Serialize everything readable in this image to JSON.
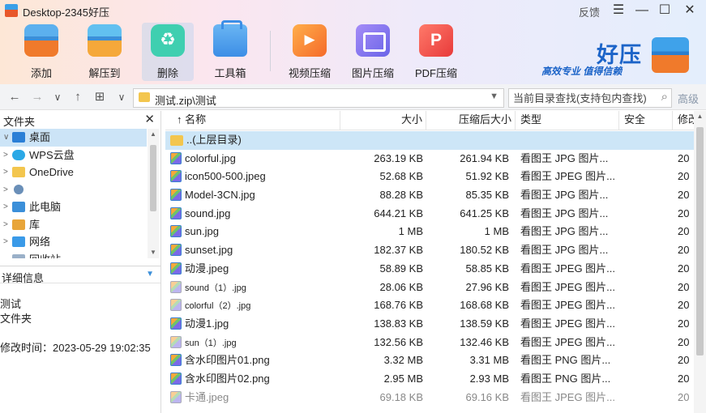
{
  "window": {
    "title": "Desktop-2345好压",
    "feedback_label": "反馈",
    "controls": {
      "menu": "☰",
      "minimize": "—",
      "maximize": "☐",
      "close": "✕"
    }
  },
  "toolbar": {
    "buttons": [
      {
        "label": "添加",
        "icon": "add-archive-icon"
      },
      {
        "label": "解压到",
        "icon": "extract-icon"
      },
      {
        "label": "删除",
        "icon": "recycle-icon"
      },
      {
        "label": "工具箱",
        "icon": "toolbox-icon"
      },
      {
        "label": "视频压缩",
        "icon": "video-compress-icon"
      },
      {
        "label": "图片压缩",
        "icon": "image-compress-icon"
      },
      {
        "label": "PDF压缩",
        "icon": "pdf-compress-icon"
      }
    ],
    "active": "删除"
  },
  "brand": {
    "name": "好压",
    "slogan": "高效专业 值得信赖"
  },
  "nav": {
    "back": "←",
    "forward": "→",
    "history": "∨",
    "up": "↑",
    "view": "⊞",
    "view_dropdown": "∨",
    "address": "测试.zip\\测试",
    "search_placeholder": "当前目录查找(支持包内查找)",
    "advanced_label": "高级"
  },
  "folder_panel": {
    "title": "文件夹",
    "items": [
      {
        "label": "桌面",
        "icon": "desktop-icon",
        "selected": true,
        "chevron": "∨"
      },
      {
        "label": "WPS云盘",
        "icon": "cloud-icon",
        "selected": false,
        "chevron": ">"
      },
      {
        "label": "OneDrive",
        "icon": "folder-icon",
        "selected": false,
        "chevron": ">"
      },
      {
        "label": "",
        "icon": "user-icon",
        "selected": false,
        "chevron": ">"
      },
      {
        "label": "此电脑",
        "icon": "computer-icon",
        "selected": false,
        "chevron": ">"
      },
      {
        "label": "库",
        "icon": "library-icon",
        "selected": false,
        "chevron": ">"
      },
      {
        "label": "网络",
        "icon": "network-icon",
        "selected": false,
        "chevron": ">"
      },
      {
        "label": "回收站",
        "icon": "recycle-bin-icon",
        "selected": false,
        "chevron": ""
      }
    ]
  },
  "details": {
    "title": "详细信息",
    "name": "测试",
    "type": "文件夹",
    "modified": "修改时间：2023-05-29 19:02:35"
  },
  "file_list": {
    "columns": [
      "名称",
      "大小",
      "压缩后大小",
      "类型",
      "安全",
      "修改"
    ],
    "sort_indicator": "↑",
    "rows": [
      {
        "name": "..(上层目录)",
        "size": "",
        "packed": "",
        "type": "",
        "mod": "",
        "kind": "dir",
        "style": "sel"
      },
      {
        "name": "colorful.jpg",
        "size": "263.19 KB",
        "packed": "261.94 KB",
        "type": "看图王 JPG 图片...",
        "mod": "20",
        "kind": "img",
        "style": ""
      },
      {
        "name": "icon500-500.jpeg",
        "size": "52.68 KB",
        "packed": "51.92 KB",
        "type": "看图王 JPEG 图片...",
        "mod": "20",
        "kind": "img",
        "style": ""
      },
      {
        "name": "Model-3CN.jpg",
        "size": "88.28 KB",
        "packed": "85.35 KB",
        "type": "看图王 JPG 图片...",
        "mod": "20",
        "kind": "img",
        "style": ""
      },
      {
        "name": "sound.jpg",
        "size": "644.21 KB",
        "packed": "641.25 KB",
        "type": "看图王 JPG 图片...",
        "mod": "20",
        "kind": "img",
        "style": ""
      },
      {
        "name": "sun.jpg",
        "size": "1 MB",
        "packed": "1 MB",
        "type": "看图王 JPG 图片...",
        "mod": "20",
        "kind": "img",
        "style": ""
      },
      {
        "name": "sunset.jpg",
        "size": "182.37 KB",
        "packed": "180.52 KB",
        "type": "看图王 JPG 图片...",
        "mod": "20",
        "kind": "img",
        "style": ""
      },
      {
        "name": "动漫.jpeg",
        "size": "58.89 KB",
        "packed": "58.85 KB",
        "type": "看图王 JPEG 图片...",
        "mod": "20",
        "kind": "img",
        "style": ""
      },
      {
        "name": "sound（1）.jpg",
        "size": "28.06 KB",
        "packed": "27.96 KB",
        "type": "看图王 JPEG 图片...",
        "mod": "20",
        "kind": "img",
        "style": "small"
      },
      {
        "name": "colorful（2）.jpg",
        "size": "168.76 KB",
        "packed": "168.68 KB",
        "type": "看图王 JPEG 图片...",
        "mod": "20",
        "kind": "img",
        "style": "small"
      },
      {
        "name": "动漫1.jpg",
        "size": "138.83 KB",
        "packed": "138.59 KB",
        "type": "看图王 JPEG 图片...",
        "mod": "20",
        "kind": "img",
        "style": ""
      },
      {
        "name": "sun（1）.jpg",
        "size": "132.56 KB",
        "packed": "132.46 KB",
        "type": "看图王 JPEG 图片...",
        "mod": "20",
        "kind": "img",
        "style": "small"
      },
      {
        "name": "含水印图片01.png",
        "size": "3.32 MB",
        "packed": "3.31 MB",
        "type": "看图王 PNG 图片...",
        "mod": "20",
        "kind": "img",
        "style": ""
      },
      {
        "name": "含水印图片02.png",
        "size": "2.95 MB",
        "packed": "2.93 MB",
        "type": "看图王 PNG 图片...",
        "mod": "20",
        "kind": "img",
        "style": ""
      },
      {
        "name": "卡通.jpeg",
        "size": "69.18 KB",
        "packed": "69.16 KB",
        "type": "看图王 JPEG 图片...",
        "mod": "20",
        "kind": "img",
        "style": "dim"
      }
    ]
  }
}
